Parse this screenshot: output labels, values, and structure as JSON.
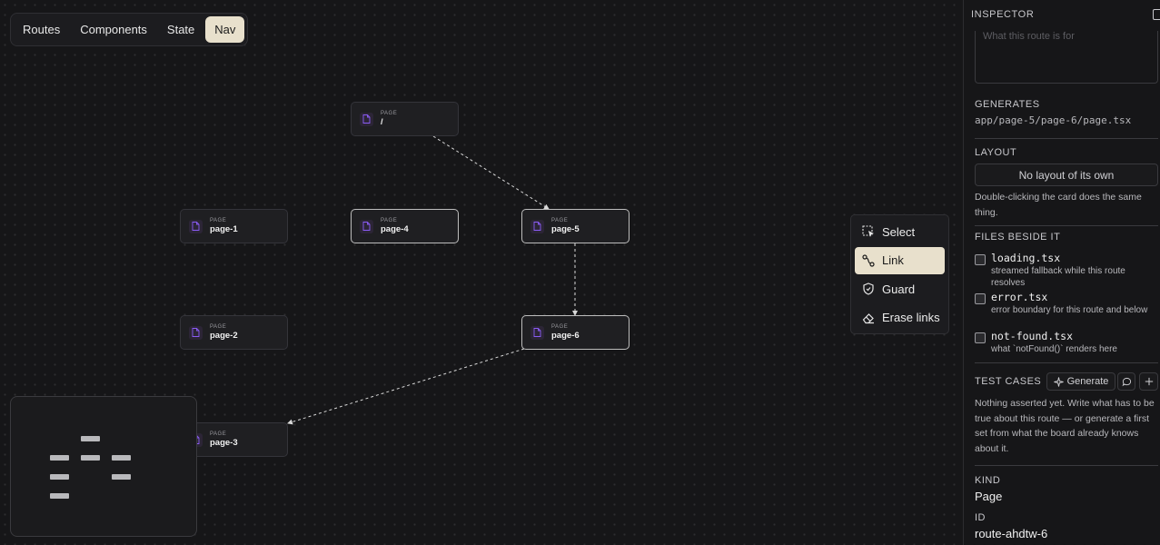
{
  "tabs": [
    {
      "label": "Routes"
    },
    {
      "label": "Components"
    },
    {
      "label": "State"
    },
    {
      "label": "Nav"
    }
  ],
  "active_tab": "Nav",
  "nodes": [
    {
      "kind": "PAGE",
      "name": "/"
    },
    {
      "kind": "PAGE",
      "name": "page-1"
    },
    {
      "kind": "PAGE",
      "name": "page-4"
    },
    {
      "kind": "PAGE",
      "name": "page-5"
    },
    {
      "kind": "PAGE",
      "name": "page-2"
    },
    {
      "kind": "PAGE",
      "name": "page-6"
    },
    {
      "kind": "PAGE",
      "name": "page-3"
    }
  ],
  "tools": [
    {
      "label": "Select",
      "icon": "select-icon"
    },
    {
      "label": "Link",
      "icon": "link-icon"
    },
    {
      "label": "Guard",
      "icon": "shield-icon"
    },
    {
      "label": "Erase links",
      "icon": "eraser-icon"
    }
  ],
  "active_tool": "Link",
  "inspector": {
    "title": "INSPECTOR",
    "purpose_placeholder": "What this route is for",
    "generates_label": "GENERATES",
    "generates_path": "app/page-5/page-6/page.tsx",
    "layout_label": "LAYOUT",
    "layout_button": "No layout of its own",
    "layout_note": "Double-clicking the card does the same thing.",
    "files_label": "FILES BESIDE IT",
    "files": [
      {
        "name": "loading.tsx",
        "desc": "streamed fallback while this route resolves"
      },
      {
        "name": "error.tsx",
        "desc": "error boundary for this route and below"
      },
      {
        "name": "not-found.tsx",
        "desc": "what `notFound()` renders here"
      }
    ],
    "tests_label": "TEST CASES",
    "generate_button": "Generate",
    "tests_note": "Nothing asserted yet. Write what has to be true about this route — or generate a first set from what the board already knows about it.",
    "kind_label": "KIND",
    "kind_value": "Page",
    "id_label": "ID",
    "id_value": "route-ahdtw-6"
  },
  "colors": {
    "accent": "#e8e0cc",
    "page_icon": "#8b5cf6",
    "canvas": "#161618"
  }
}
